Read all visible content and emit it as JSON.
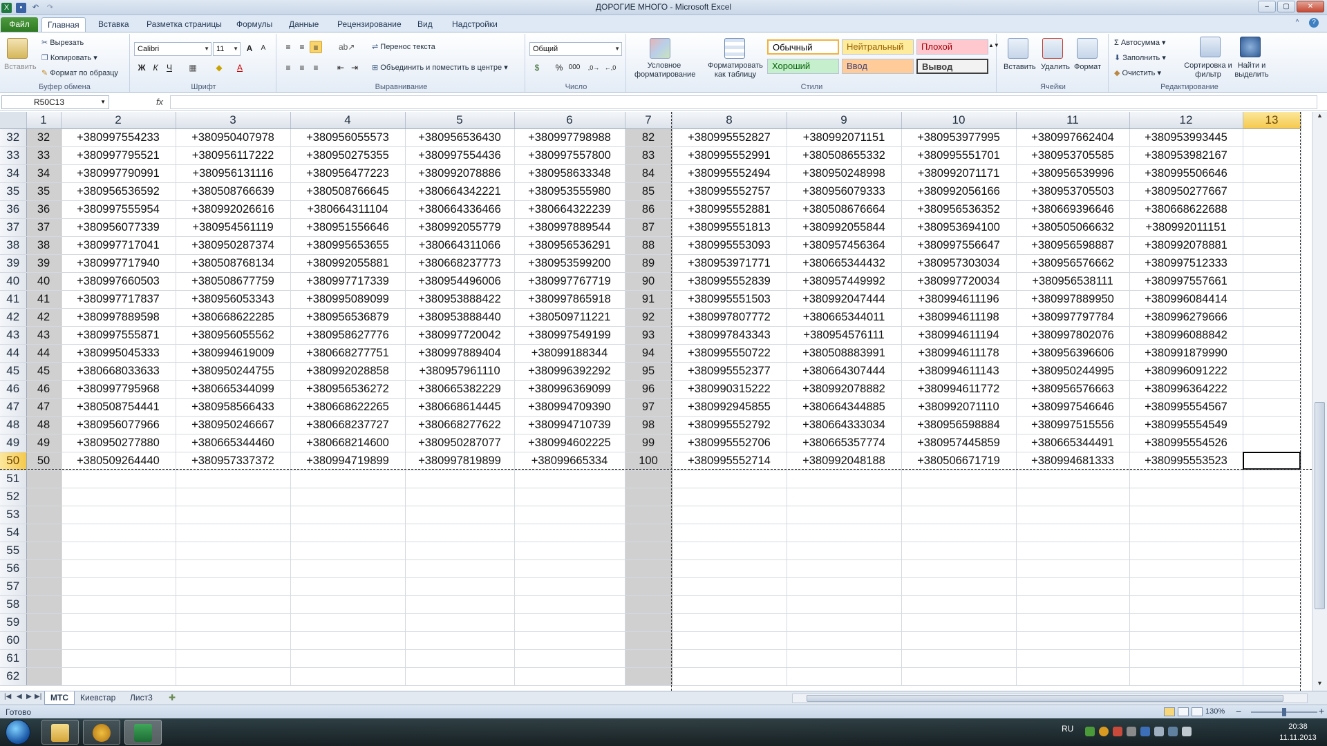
{
  "window": {
    "title": "ДОРОГИЕ МНОГО  -  Microsoft Excel",
    "minimize": "–",
    "maximize": "▢",
    "close": "✕"
  },
  "ribbon_tabs": [
    "Файл",
    "Главная",
    "Вставка",
    "Разметка страницы",
    "Формулы",
    "Данные",
    "Рецензирование",
    "Вид",
    "Надстройки"
  ],
  "clipboard": {
    "paste": "Вставить",
    "cut": "Вырезать",
    "copy": "Копировать",
    "format_painter": "Формат по образцу",
    "group": "Буфер обмена"
  },
  "font": {
    "name": "Calibri",
    "size": "11",
    "bold": "Ж",
    "italic": "К",
    "underline": "Ч",
    "group": "Шрифт"
  },
  "alignment": {
    "wrap": "Перенос текста",
    "merge": "Объединить и поместить в центре",
    "group": "Выравнивание"
  },
  "number": {
    "format": "Общий",
    "percent": "%",
    "thousands": "000",
    "group": "Число"
  },
  "styles": {
    "conditional": "Условное форматирование",
    "as_table": "Форматировать как таблицу",
    "normal": "Обычный",
    "neutral": "Нейтральный",
    "bad": "Плохой",
    "good": "Хороший",
    "input": "Ввод",
    "output": "Вывод",
    "group": "Стили",
    "colors": {
      "normal_bg": "#ffffff",
      "neutral_bg": "#ffeb9c",
      "neutral_fg": "#9c6500",
      "bad_bg": "#ffc7ce",
      "bad_fg": "#9c0006",
      "good_bg": "#c6efce",
      "good_fg": "#006100",
      "input_bg": "#ffcc99",
      "input_fg": "#3f3f76",
      "output_bg": "#f2f2f2",
      "output_fg": "#3f3f3f"
    }
  },
  "cells_group": {
    "insert": "Вставить",
    "delete": "Удалить",
    "format": "Формат",
    "group": "Ячейки"
  },
  "editing": {
    "autosum": "Автосумма",
    "fill": "Заполнить",
    "clear": "Очистить",
    "sort": "Сортировка и фильтр",
    "find": "Найти и выделить",
    "group": "Редактирование"
  },
  "formula_bar": {
    "name_box": "R50C13",
    "fx": "fx",
    "value": ""
  },
  "sheet": {
    "columns": [
      "1",
      "2",
      "3",
      "4",
      "5",
      "6",
      "7",
      "8",
      "9",
      "10",
      "11",
      "12",
      "13"
    ],
    "selected_column": "13",
    "selected_row": 50,
    "rows": [
      {
        "n": "32",
        "c": [
          "32",
          "+380997554233",
          "+380950407978",
          "+380956055573",
          "+380956536430",
          "+380997798988",
          "82",
          "+380995552827",
          "+380992071151",
          "+380953977995",
          "+380997662404",
          "+380953993445",
          ""
        ]
      },
      {
        "n": "33",
        "c": [
          "33",
          "+380997795521",
          "+380956117222",
          "+380950275355",
          "+380997554436",
          "+380997557800",
          "83",
          "+380995552991",
          "+380508655332",
          "+380995551701",
          "+380953705585",
          "+380953982167",
          ""
        ]
      },
      {
        "n": "34",
        "c": [
          "34",
          "+380997790991",
          "+380956131116",
          "+380956477223",
          "+380992078886",
          "+380958633348",
          "84",
          "+380995552494",
          "+380950248998",
          "+380992071171",
          "+380956539996",
          "+380995506646",
          ""
        ]
      },
      {
        "n": "35",
        "c": [
          "35",
          "+380956536592",
          "+380508766639",
          "+380508766645",
          "+380664342221",
          "+380953555980",
          "85",
          "+380995552757",
          "+380956079333",
          "+380992056166",
          "+380953705503",
          "+380950277667",
          ""
        ]
      },
      {
        "n": "36",
        "c": [
          "36",
          "+380997555954",
          "+380992026616",
          "+380664311104",
          "+380664336466",
          "+380664322239",
          "86",
          "+380995552881",
          "+380508676664",
          "+380956536352",
          "+380669396646",
          "+380668622688",
          ""
        ]
      },
      {
        "n": "37",
        "c": [
          "37",
          "+380956077339",
          "+380954561119",
          "+380951556646",
          "+380992055779",
          "+380997889544",
          "87",
          "+380995551813",
          "+380992055844",
          "+380953694100",
          "+380505066632",
          "+380992011151",
          ""
        ]
      },
      {
        "n": "38",
        "c": [
          "38",
          "+380997717041",
          "+380950287374",
          "+380995653655",
          "+380664311066",
          "+380956536291",
          "88",
          "+380995553093",
          "+380957456364",
          "+380997556647",
          "+380956598887",
          "+380992078881",
          ""
        ]
      },
      {
        "n": "39",
        "c": [
          "39",
          "+380997717940",
          "+380508768134",
          "+380992055881",
          "+380668237773",
          "+380953599200",
          "89",
          "+380953971771",
          "+380665344432",
          "+380957303034",
          "+380956576662",
          "+380997512333",
          ""
        ]
      },
      {
        "n": "40",
        "c": [
          "40",
          "+380997660503",
          "+380508677759",
          "+380997717339",
          "+380954496006",
          "+380997767719",
          "90",
          "+380995552839",
          "+380957449992",
          "+380997720034",
          "+380956538111",
          "+380997557661",
          ""
        ]
      },
      {
        "n": "41",
        "c": [
          "41",
          "+380997717837",
          "+380956053343",
          "+380995089099",
          "+380953888422",
          "+380997865918",
          "91",
          "+380995551503",
          "+380992047444",
          "+380994611196",
          "+380997889950",
          "+380996084414",
          ""
        ]
      },
      {
        "n": "42",
        "c": [
          "42",
          "+380997889598",
          "+380668622285",
          "+380956536879",
          "+380953888440",
          "+380509711221",
          "92",
          "+380997807772",
          "+380665344011",
          "+380994611198",
          "+380997797784",
          "+380996279666",
          ""
        ]
      },
      {
        "n": "43",
        "c": [
          "43",
          "+380997555871",
          "+380956055562",
          "+380958627776",
          "+380997720042",
          "+380997549199",
          "93",
          "+380997843343",
          "+380954576111",
          "+380994611194",
          "+380997802076",
          "+380996088842",
          ""
        ]
      },
      {
        "n": "44",
        "c": [
          "44",
          "+380995045333",
          "+380994619009",
          "+380668277751",
          "+380997889404",
          "+38099188344",
          "94",
          "+380995550722",
          "+380508883991",
          "+380994611178",
          "+380956396606",
          "+380991879990",
          ""
        ]
      },
      {
        "n": "45",
        "c": [
          "45",
          "+380668033633",
          "+380950244755",
          "+380992028858",
          "+380957961110",
          "+380996392292",
          "95",
          "+380995552377",
          "+380664307444",
          "+380994611143",
          "+380950244995",
          "+380996091222",
          ""
        ]
      },
      {
        "n": "46",
        "c": [
          "46",
          "+380997795968",
          "+380665344099",
          "+380956536272",
          "+380665382229",
          "+380996369099",
          "96",
          "+380990315222",
          "+380992078882",
          "+380994611772",
          "+380956576663",
          "+380996364222",
          ""
        ]
      },
      {
        "n": "47",
        "c": [
          "47",
          "+380508754441",
          "+380958566433",
          "+380668622265",
          "+380668614445",
          "+380994709390",
          "97",
          "+380992945855",
          "+380664344885",
          "+380992071110",
          "+380997546646",
          "+380995554567",
          ""
        ]
      },
      {
        "n": "48",
        "c": [
          "48",
          "+380956077966",
          "+380950246667",
          "+380668237727",
          "+380668277622",
          "+380994710739",
          "98",
          "+380995552792",
          "+380664333034",
          "+380956598884",
          "+380997515556",
          "+380995554549",
          ""
        ]
      },
      {
        "n": "49",
        "c": [
          "49",
          "+380950277880",
          "+380665344460",
          "+380668214600",
          "+380950287077",
          "+380994602225",
          "99",
          "+380995552706",
          "+380665357774",
          "+380957445859",
          "+380665344491",
          "+380995554526",
          ""
        ]
      },
      {
        "n": "50",
        "c": [
          "50",
          "+380509264440",
          "+380957337372",
          "+380994719899",
          "+380997819899",
          "+38099665334",
          "100",
          "+380995552714",
          "+380992048188",
          "+380506671719",
          "+380994681333",
          "+380995553523",
          ""
        ]
      },
      {
        "n": "51",
        "c": [
          "",
          "",
          "",
          "",
          "",
          "",
          "",
          "",
          "",
          "",
          "",
          "",
          ""
        ]
      },
      {
        "n": "52",
        "c": [
          "",
          "",
          "",
          "",
          "",
          "",
          "",
          "",
          "",
          "",
          "",
          "",
          ""
        ]
      },
      {
        "n": "53",
        "c": [
          "",
          "",
          "",
          "",
          "",
          "",
          "",
          "",
          "",
          "",
          "",
          "",
          ""
        ]
      },
      {
        "n": "54",
        "c": [
          "",
          "",
          "",
          "",
          "",
          "",
          "",
          "",
          "",
          "",
          "",
          "",
          ""
        ]
      },
      {
        "n": "55",
        "c": [
          "",
          "",
          "",
          "",
          "",
          "",
          "",
          "",
          "",
          "",
          "",
          "",
          ""
        ]
      },
      {
        "n": "56",
        "c": [
          "",
          "",
          "",
          "",
          "",
          "",
          "",
          "",
          "",
          "",
          "",
          "",
          ""
        ]
      },
      {
        "n": "57",
        "c": [
          "",
          "",
          "",
          "",
          "",
          "",
          "",
          "",
          "",
          "",
          "",
          "",
          ""
        ]
      },
      {
        "n": "58",
        "c": [
          "",
          "",
          "",
          "",
          "",
          "",
          "",
          "",
          "",
          "",
          "",
          "",
          ""
        ]
      },
      {
        "n": "59",
        "c": [
          "",
          "",
          "",
          "",
          "",
          "",
          "",
          "",
          "",
          "",
          "",
          "",
          ""
        ]
      },
      {
        "n": "60",
        "c": [
          "",
          "",
          "",
          "",
          "",
          "",
          "",
          "",
          "",
          "",
          "",
          "",
          ""
        ]
      },
      {
        "n": "61",
        "c": [
          "",
          "",
          "",
          "",
          "",
          "",
          "",
          "",
          "",
          "",
          "",
          "",
          ""
        ]
      },
      {
        "n": "62",
        "c": [
          "",
          "",
          "",
          "",
          "",
          "",
          "",
          "",
          "",
          "",
          "",
          "",
          ""
        ]
      }
    ]
  },
  "sheet_tabs": [
    "МТС",
    "Киевстар",
    "Лист3"
  ],
  "status": {
    "ready": "Готово",
    "zoom": "130%"
  },
  "taskbar": {
    "lang": "RU",
    "time": "20:38",
    "date": "11.11.2013"
  },
  "icons": [
    "excel-icon",
    "save-icon",
    "undo-icon",
    "redo-icon",
    "help-icon",
    "folder-icon",
    "excel-taskbar-icon",
    "app-triangle-icon",
    "windows-start-icon"
  ]
}
